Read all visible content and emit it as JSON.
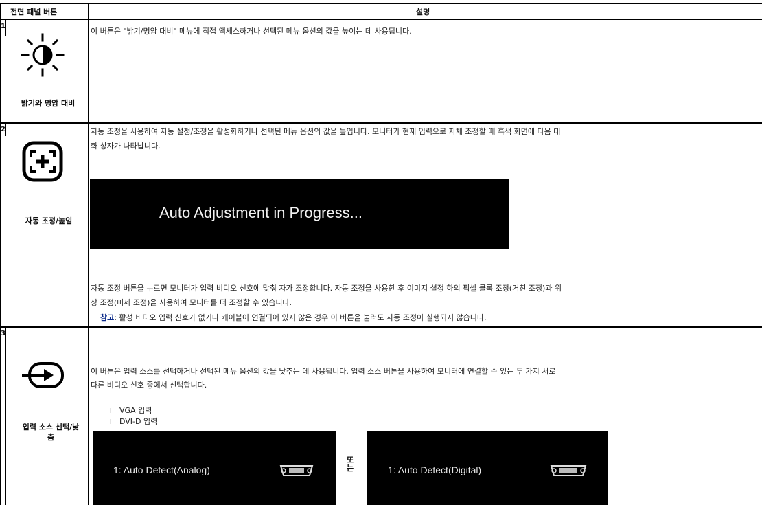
{
  "header": {
    "col_button": "전면 패널 버튼",
    "col_desc": "설명"
  },
  "rows": [
    {
      "number": "1",
      "icon": "brightness-contrast-icon",
      "label": "밝기와 명암 대비",
      "desc": "이 버튼은 \"밝기/명암 대비\" 메뉴에 직접 액세스하거나 선택된 메뉴 옵션의 값을 높이는 데 사용됩니다."
    },
    {
      "number": "2",
      "icon": "auto-adjust-icon",
      "label": "자동 조정/높임",
      "desc_line1": "자동 조정을 사용하여 자동 설정/조정을 활성화하거나 선택된 메뉴 옵션의 값을 높입니다. 모니터가 현재 입력으로 자체 조정할 때 흑색 화면에 다음 대",
      "desc_line2": "화 상자가 나타납니다.",
      "osd_text": "Auto Adjustment in Progress...",
      "para_line1": "자동 조정 버튼을 누르면 모니터가 입력 비디오 신호에 맞춰 자가 조정합니다. 자동 조정을 사용한 후 이미지 설정 하의 픽셀 클록 조정(거친 조정)과 위",
      "para_line2": "상 조정(미세 조정)을 사용하여 모니터를 더 조정할 수 있습니다.",
      "note_key": "참고",
      "note_text": ": 활성 비디오 입력 신호가 없거나 케이블이 연결되어 있지 않은 경우 이 버튼을 눌러도 자동 조정이 실행되지 않습니다."
    },
    {
      "number": "3",
      "icon": "input-source-icon",
      "label": "입력 소스 선택/낮춤",
      "desc_line1": "이 버튼은 입력 소스를 선택하거나 선택된 메뉴 옵션의 값을 낮추는 데 사용됩니다. 입력 소스 버튼을 사용하여 모니터에 연결할 수 있는 두 가지 서로",
      "desc_line2": "다른 비디오 신호 중에서 선택합니다.",
      "bullet_glyph": "l",
      "bullets": [
        "VGA 입력",
        "DVI-D 입력"
      ],
      "osd_analog": "1: Auto Detect(Analog)",
      "osd_digital": "1: Auto Detect(Digital)",
      "or_text": "또는"
    }
  ]
}
